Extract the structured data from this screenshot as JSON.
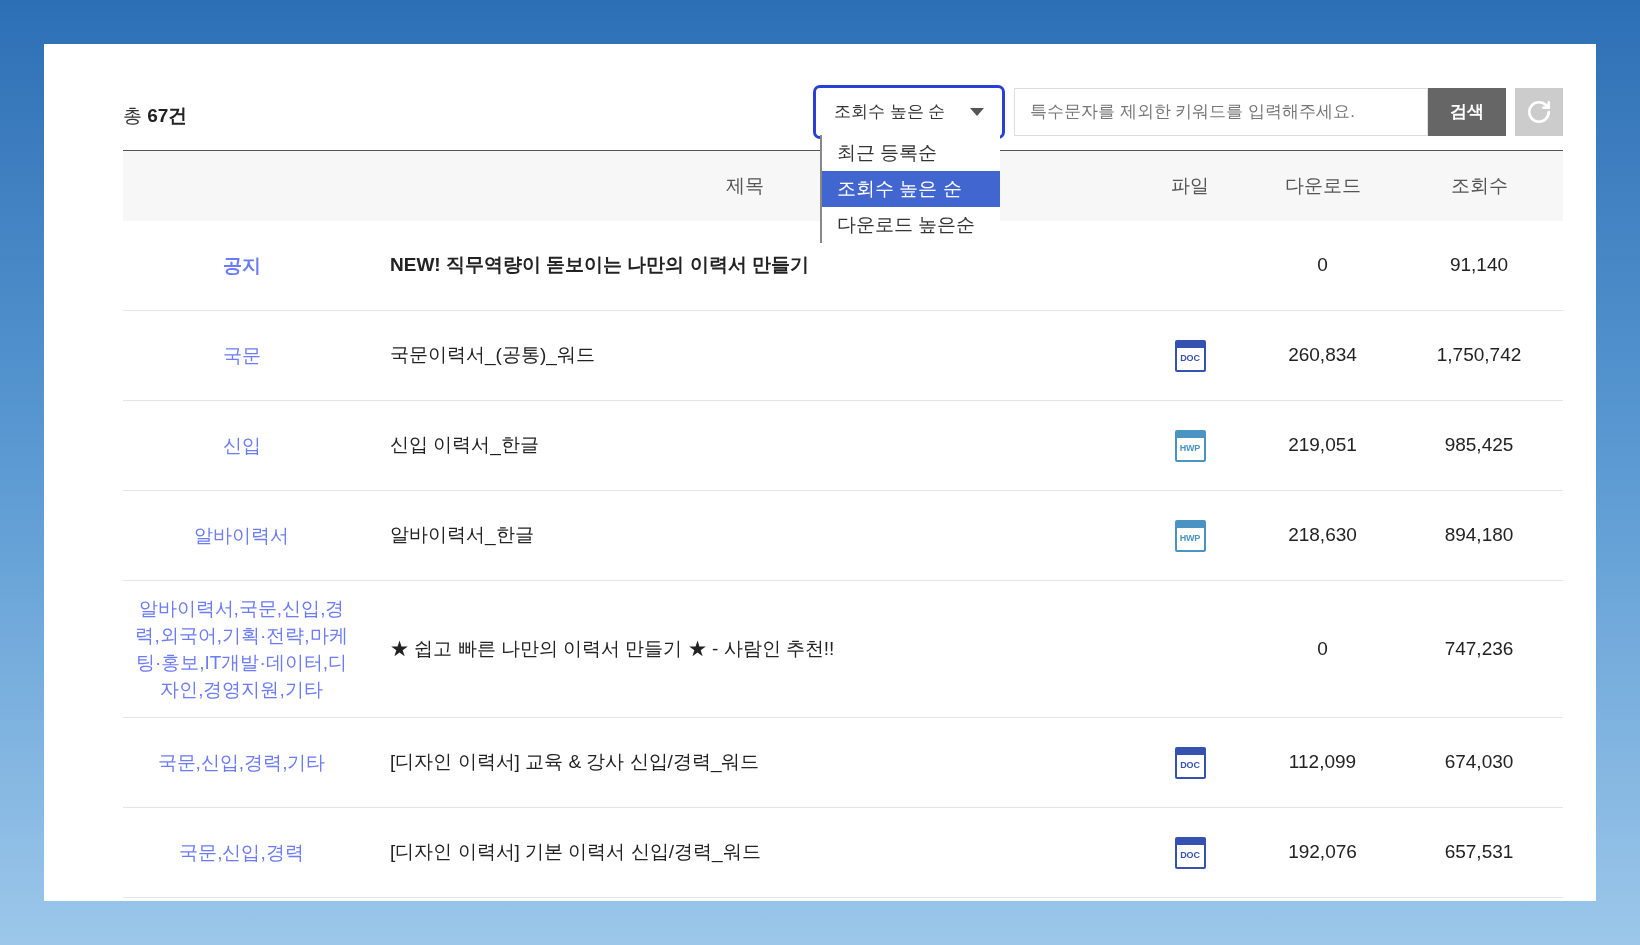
{
  "total": {
    "prefix": "총",
    "count": "67건"
  },
  "sort": {
    "value": "조회수 높은 순",
    "focused": true,
    "expanded": true,
    "options": [
      {
        "label": "최근 등록순",
        "selected": false
      },
      {
        "label": "조회수 높은 순",
        "selected": true
      },
      {
        "label": "다운로드 높은순",
        "selected": false
      }
    ]
  },
  "search": {
    "placeholder": "특수문자를 제외한 키워드를 입력해주세요.",
    "button": "검색"
  },
  "table": {
    "columns": [
      "제목",
      "파일",
      "다운로드",
      "조회수"
    ],
    "rows": [
      {
        "kind": "notice",
        "category": "공지",
        "title": "NEW! 직무역량이 돋보이는 나만의 이력서 만들기",
        "downloads": "0",
        "views": "91,140"
      },
      {
        "kind": "normal",
        "category": "국문",
        "title": "국문이력서_(공통)_워드",
        "file": {
          "kind": "doc",
          "label": "DOC"
        },
        "downloads": "260,834",
        "views": "1,750,742"
      },
      {
        "kind": "normal",
        "category": "신입",
        "title": "신입 이력서_한글",
        "file": {
          "kind": "hwp",
          "label": "HWP"
        },
        "downloads": "219,051",
        "views": "985,425"
      },
      {
        "kind": "normal",
        "category": "알바이력서",
        "title": "알바이력서_한글",
        "file": {
          "kind": "hwp",
          "label": "HWP"
        },
        "downloads": "218,630",
        "views": "894,180"
      },
      {
        "kind": "normal",
        "category": "알바이력서,국문,신입,경력,외국어,기획·전략,마케팅·홍보,IT개발·데이터,디자인,경영지원,기타",
        "title": "★ 쉽고 빠른 나만의 이력서 만들기 ★ - 사람인 추천!!",
        "downloads": "0",
        "views": "747,236"
      },
      {
        "kind": "normal",
        "category": "국문,신입,경력,기타",
        "title": "[디자인 이력서] 교육 & 강사 신입/경력_워드",
        "file": {
          "kind": "doc",
          "label": "DOC"
        },
        "downloads": "112,099",
        "views": "674,030"
      },
      {
        "kind": "normal",
        "category": "국문,신입,경력",
        "title": "[디자인 이력서] 기본 이력서 신입/경력_워드",
        "file": {
          "kind": "doc",
          "label": "DOC"
        },
        "downloads": "192,076",
        "views": "657,531"
      }
    ]
  }
}
